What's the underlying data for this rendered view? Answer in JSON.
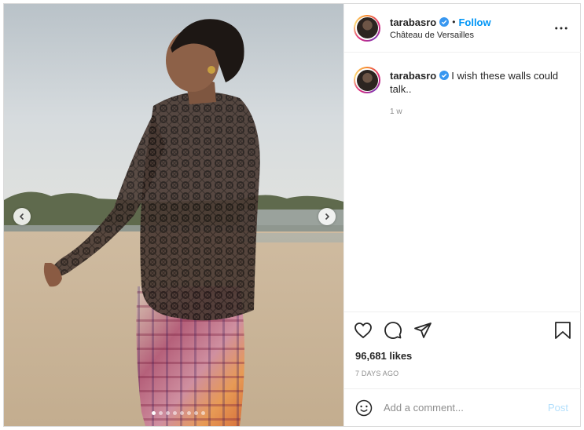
{
  "post": {
    "author": {
      "username": "tarabasro",
      "verified": true,
      "follow_label": "Follow",
      "separator": "•",
      "location": "Château de Versailles"
    },
    "caption": {
      "username": "tarabasro",
      "text": "I wish these walls could talk..",
      "relative_time": "1 w"
    },
    "likes": "96,681 likes",
    "posted_ago": "7 DAYS AGO",
    "carousel": {
      "total": 8,
      "active_index": 0
    },
    "comment": {
      "placeholder": "Add a comment...",
      "post_label": "Post"
    }
  },
  "colors": {
    "link_blue": "#0095f6",
    "post_disabled": "#b2dffc",
    "muted_text": "#8e8e8e",
    "border": "#dbdbdb"
  },
  "icons": {
    "header": [
      "verified-badge-icon",
      "more-options-icon"
    ],
    "actions": [
      "heart-icon",
      "comment-icon",
      "share-icon",
      "bookmark-icon"
    ],
    "media": [
      "chevron-left-icon",
      "chevron-right-icon"
    ],
    "comment": [
      "emoji-icon"
    ]
  }
}
